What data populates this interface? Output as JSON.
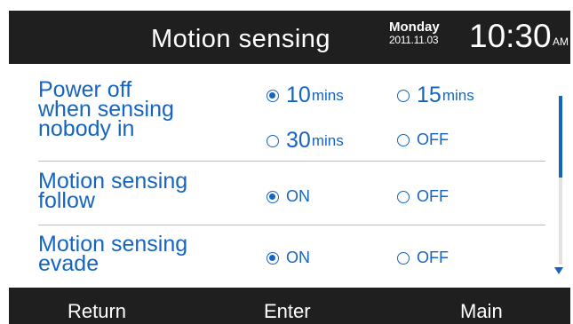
{
  "header": {
    "title": "Motion sensing",
    "day": "Monday",
    "date": "2011.11.03",
    "time": "10:30",
    "ampm": "AM"
  },
  "rows": [
    {
      "label_lines": [
        "Power off",
        "when sensing",
        "nobody in"
      ],
      "options": [
        {
          "value": "10",
          "unit": "mins",
          "selected": true
        },
        {
          "value": "15",
          "unit": "mins",
          "selected": false
        },
        {
          "value": "30",
          "unit": "mins",
          "selected": false
        },
        {
          "value": "OFF",
          "selected": false
        }
      ]
    },
    {
      "label_lines": [
        "Motion sensing",
        "follow"
      ],
      "options": [
        {
          "value": "ON",
          "selected": true
        },
        {
          "value": "OFF",
          "selected": false
        }
      ]
    },
    {
      "label_lines": [
        "Motion sensing",
        "evade"
      ],
      "options": [
        {
          "value": "ON",
          "selected": true
        },
        {
          "value": "OFF",
          "selected": false
        }
      ]
    }
  ],
  "footer": {
    "return_label": "Return",
    "enter_label": "Enter",
    "main_label": "Main"
  },
  "colors": {
    "accent": "#1565c0",
    "bar": "#1f1f1f",
    "divider": "#a7c4dc"
  }
}
